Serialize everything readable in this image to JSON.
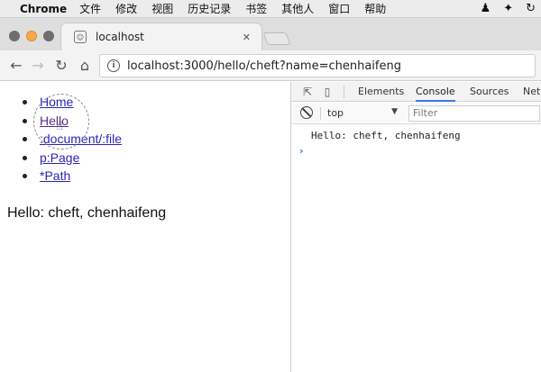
{
  "menubar": {
    "app_name": "Chrome",
    "items": [
      "文件",
      "修改",
      "视图",
      "历史记录",
      "书签",
      "其他人",
      "窗口",
      "帮助"
    ],
    "tray_icons": [
      "person-icon",
      "bird-icon",
      "sync-icon"
    ]
  },
  "tab": {
    "title": "localhost",
    "close_label": "✕"
  },
  "toolbar": {
    "back": "←",
    "forward": "→",
    "reload": "↻",
    "home": "⌂",
    "info": "i",
    "url": "localhost:3000/hello/cheft?name=chenhaifeng"
  },
  "page": {
    "links": [
      "Home",
      "Hello",
      ":document/:file",
      "p:Page",
      "*Path"
    ],
    "hello_text": "Hello: cheft, chenhaifeng"
  },
  "devtools": {
    "tabs": [
      "Elements",
      "Console",
      "Sources",
      "Netw"
    ],
    "active_tab": "Console",
    "context": "top",
    "filter_placeholder": "Filter",
    "console_log": "Hello: cheft, chenhaifeng",
    "prompt": "›"
  }
}
